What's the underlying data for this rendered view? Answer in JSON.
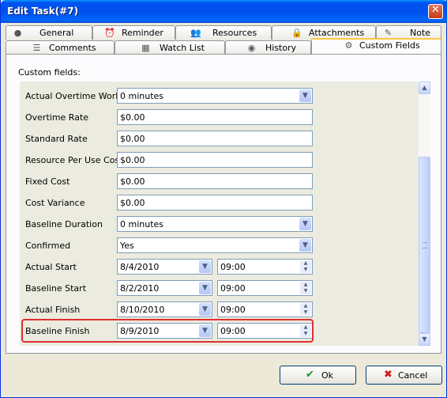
{
  "window": {
    "title": "Edit Task(#7)"
  },
  "tabs_row1": [
    {
      "label": "General",
      "icon": "globe-icon"
    },
    {
      "label": "Reminder",
      "icon": "alarm-clock-icon"
    },
    {
      "label": "Resources",
      "icon": "people-icon"
    },
    {
      "label": "Attachments",
      "icon": "paperclip-icon"
    },
    {
      "label": "Note",
      "icon": "note-icon"
    }
  ],
  "tabs_row2": [
    {
      "label": "Comments",
      "icon": "comments-icon"
    },
    {
      "label": "Watch List",
      "icon": "watch-list-icon"
    },
    {
      "label": "History",
      "icon": "history-icon"
    },
    {
      "label": "Custom Fields",
      "icon": "gear-icon",
      "active": true
    }
  ],
  "custom_fields_label": "Custom fields:",
  "fields": [
    {
      "label": "Actual Overtime Work",
      "value": "0 minutes",
      "type": "dropdown"
    },
    {
      "label": "Overtime Rate",
      "value": "$0.00",
      "type": "text"
    },
    {
      "label": "Standard Rate",
      "value": "$0.00",
      "type": "text"
    },
    {
      "label": "Resource Per Use Cost",
      "value": "$0.00",
      "type": "text"
    },
    {
      "label": "Fixed Cost",
      "value": "$0.00",
      "type": "text"
    },
    {
      "label": "Cost Variance",
      "value": "$0.00",
      "type": "text"
    },
    {
      "label": "Baseline Duration",
      "value": "0 minutes",
      "type": "dropdown"
    },
    {
      "label": "Confirmed",
      "value": "Yes",
      "type": "dropdown"
    },
    {
      "label": "Actual Start",
      "date": "8/4/2010",
      "time": "09:00",
      "type": "datetime"
    },
    {
      "label": "Baseline Start",
      "date": "8/2/2010",
      "time": "09:00",
      "type": "datetime"
    },
    {
      "label": "Actual Finish",
      "date": "8/10/2010",
      "time": "09:00",
      "type": "datetime"
    },
    {
      "label": "Baseline Finish",
      "date": "8/9/2010",
      "time": "09:00",
      "type": "datetime"
    }
  ],
  "buttons": {
    "ok": "Ok",
    "cancel": "Cancel"
  },
  "colors": {
    "title_bar": "#0053ee",
    "highlight": "#e03030",
    "ok_icon": "#1a9a1a",
    "cancel_icon": "#d01818"
  }
}
